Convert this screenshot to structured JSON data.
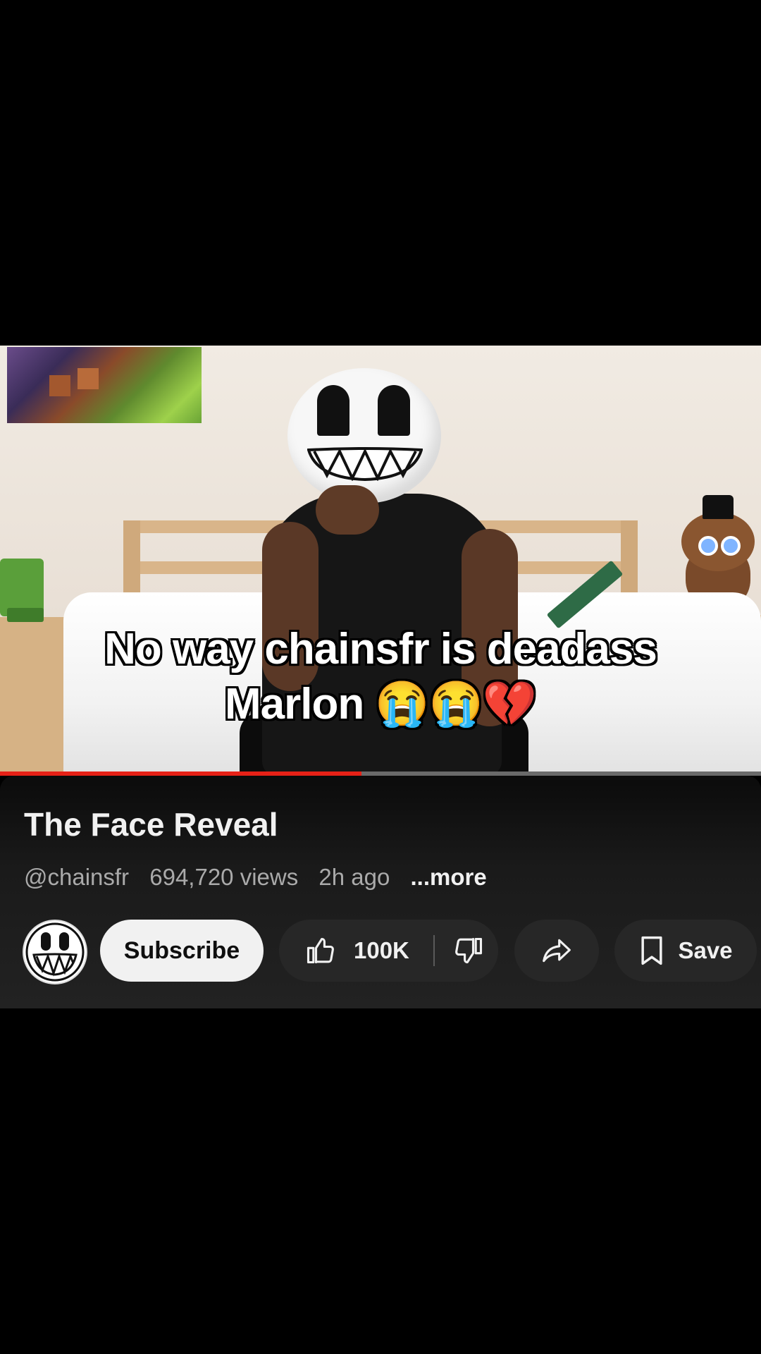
{
  "video": {
    "caption_line1": "No way chainsfr is deadass",
    "caption_line2": "Marlon 😭😭💔",
    "progress": 0.475
  },
  "info": {
    "title": "The Face Reveal",
    "channel_handle": "@chainsfr",
    "views": "694,720 views",
    "age": "2h ago",
    "more_label": "...more"
  },
  "actions": {
    "subscribe_label": "Subscribe",
    "like_count": "100K",
    "save_label": "Save"
  },
  "icons": {
    "like": "thumbs-up-icon",
    "dislike": "thumbs-down-icon",
    "share": "share-arrow-icon",
    "save": "bookmark-icon"
  },
  "colors": {
    "progress": "#e62117",
    "panel": "#1a1a1a",
    "button": "#272727",
    "subscribe_bg": "#f1f1f1"
  }
}
